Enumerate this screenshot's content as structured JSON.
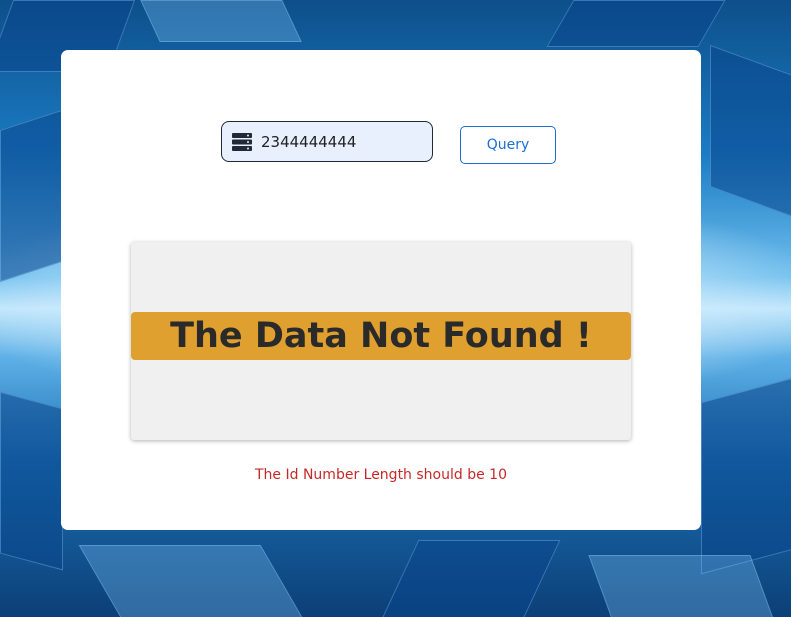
{
  "search": {
    "value": "2344444444",
    "icon": "server-icon"
  },
  "query_button": {
    "label": "Query"
  },
  "result": {
    "message": "The Data Not Found !",
    "banner_color": "#e0a030"
  },
  "validation": {
    "error": "The Id Number Length should be 10",
    "error_color": "#c62828"
  }
}
